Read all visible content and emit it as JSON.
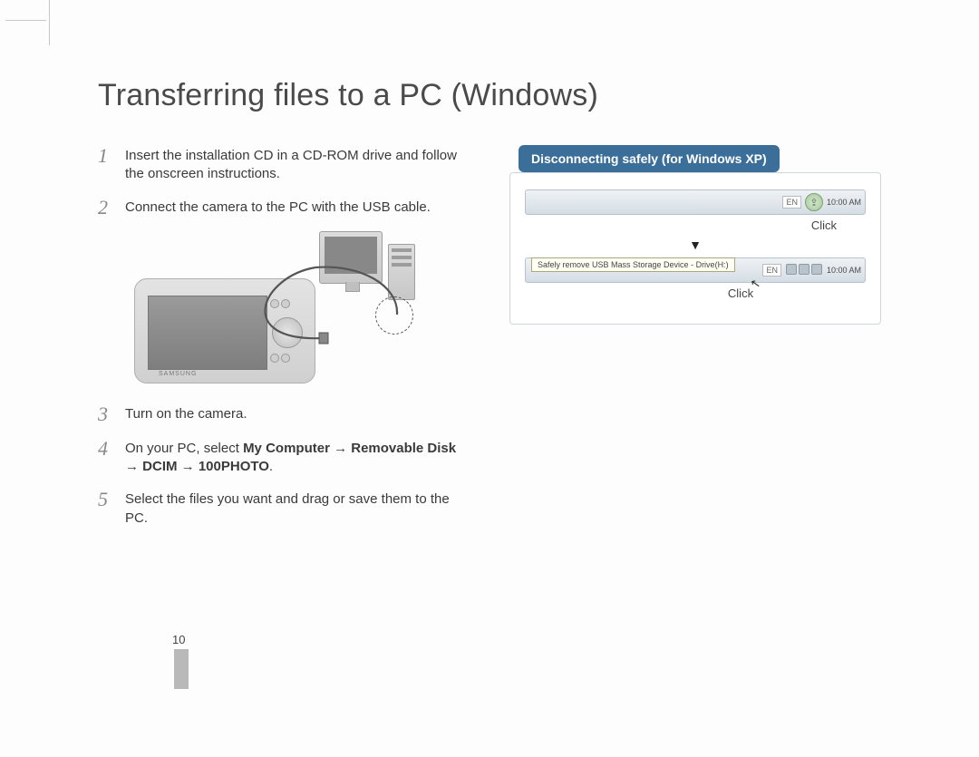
{
  "title": "Transferring files to a PC (Windows)",
  "steps": [
    {
      "num": "1",
      "text": "Insert the installation CD in a CD-ROM drive and follow the onscreen instructions."
    },
    {
      "num": "2",
      "text": "Connect the camera to the PC with the USB cable."
    },
    {
      "num": "3",
      "text": "Turn on the camera."
    },
    {
      "num": "4",
      "prefix": "On your PC, select ",
      "bold": "My Computer → Removable Disk → DCIM → 100PHOTO",
      "suffix": "."
    },
    {
      "num": "5",
      "text": "Select the files you want and drag or save them to the PC."
    }
  ],
  "callout": {
    "heading": "Disconnecting safely (for Windows XP)",
    "tray1": {
      "lang": "EN",
      "time": "10:00 AM"
    },
    "click1": "Click",
    "arrow": "▼",
    "tooltip": "Safely remove USB Mass Storage Device - Drive(H:)",
    "tray2": {
      "lang": "EN",
      "time": "10:00 AM"
    },
    "click2": "Click"
  },
  "illustration": {
    "camera_brand": "SAMSUNG"
  },
  "page_number": "10"
}
